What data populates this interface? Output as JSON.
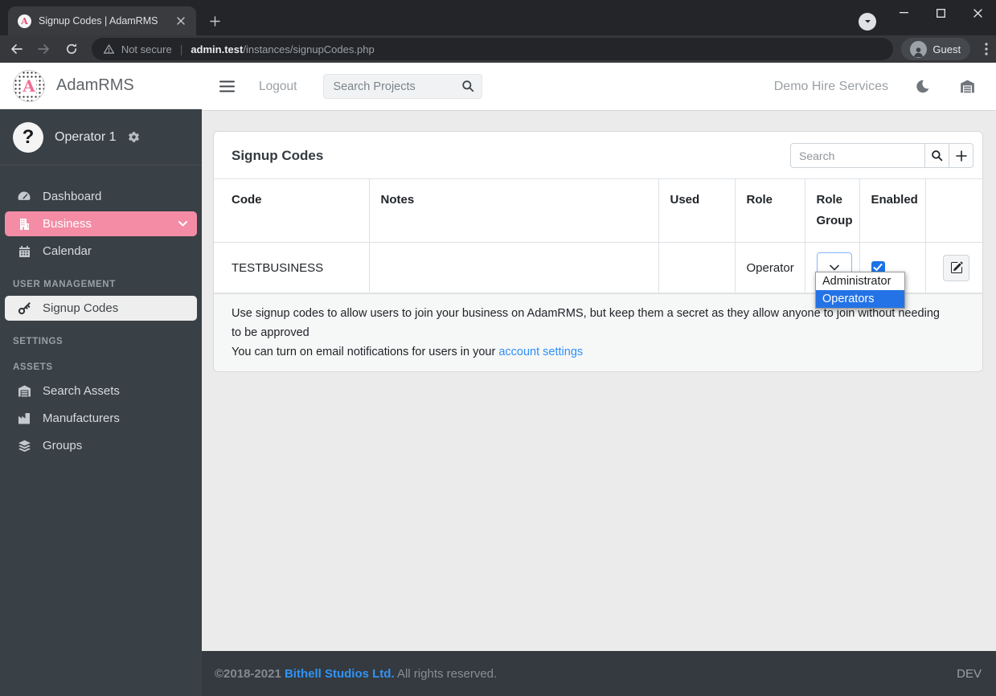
{
  "browser": {
    "tab_title": "Signup Codes | AdamRMS",
    "favicon_letter": "A",
    "security_label": "Not secure",
    "url_host": "admin.test",
    "url_path": "/instances/signupCodes.php",
    "profile_label": "Guest"
  },
  "sidebar": {
    "brand": "AdamRMS",
    "brand_letter": "A",
    "user_name": "Operator 1",
    "user_initial": "?",
    "nav": [
      {
        "label": "Dashboard"
      },
      {
        "label": "Business"
      },
      {
        "label": "Calendar"
      }
    ],
    "sections": [
      {
        "label": "USER MANAGEMENT",
        "items": [
          {
            "label": "Signup Codes"
          }
        ]
      },
      {
        "label": "SETTINGS",
        "items": []
      },
      {
        "label": "ASSETS",
        "items": [
          {
            "label": "Search Assets"
          },
          {
            "label": "Manufacturers"
          },
          {
            "label": "Groups"
          }
        ]
      }
    ]
  },
  "navbar": {
    "logout_label": "Logout",
    "search_placeholder": "Search Projects",
    "business_name": "Demo Hire Services"
  },
  "page": {
    "title": "Signup Codes",
    "search_placeholder": "Search",
    "table": {
      "headers": [
        "Code",
        "Notes",
        "Used",
        "Role",
        "Role Group",
        "Enabled",
        ""
      ],
      "rows": [
        {
          "code": "TESTBUSINESS",
          "notes": "",
          "used": "",
          "role": "Operator",
          "role_group": "",
          "enabled": true
        }
      ]
    },
    "role_group_options": [
      "Administrator",
      "Operators"
    ],
    "highlighted_option": "Operators",
    "note1_line1": "Use signup codes to allow users to join your business on AdamRMS, but keep them a secret as they allow anyone to join without needing",
    "note1_line2": "to be approved",
    "note2_prefix": "You can turn on email notifications for users in your ",
    "note2_link": "account settings"
  },
  "footer": {
    "copyright": "©2018-2021",
    "company": "Bithell Studios Ltd.",
    "rights": "All rights reserved.",
    "env": "DEV"
  },
  "colors": {
    "accent_pink": "#f48ca6",
    "sidebar_dark": "#394046",
    "footer_dark": "#343a40",
    "link_blue": "#2e90fc",
    "checkbox_blue": "#1a73e8",
    "selection_blue": "#2473e6"
  }
}
